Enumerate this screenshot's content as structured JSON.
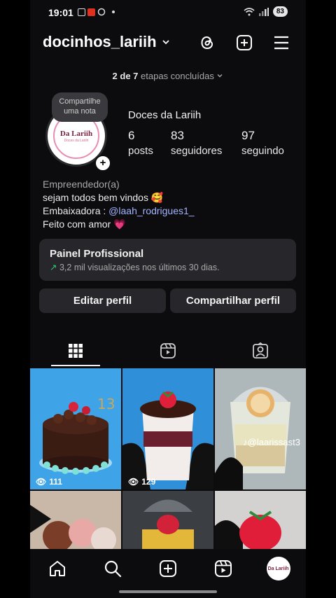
{
  "status": {
    "time": "19:01",
    "battery": "83"
  },
  "header": {
    "username": "docinhos_lariih"
  },
  "steps": {
    "count": "2 de 7",
    "label": "etapas concluídas"
  },
  "note": {
    "text": "Compartilhe uma nota"
  },
  "avatar": {
    "logo_text": "Da Lariih",
    "logo_sub": "Doces da Lariih"
  },
  "profile": {
    "name": "Doces da Lariih",
    "stats": [
      {
        "value": "6",
        "label": "posts"
      },
      {
        "value": "83",
        "label": "seguidores"
      },
      {
        "value": "97",
        "label": "seguindo"
      }
    ],
    "bio": {
      "category": "Empreendedor(a)",
      "line1": "sejam todos bem vindos 🥰",
      "line2_prefix": "Embaixadora : ",
      "line2_mention": "@laah_rodrigues1_",
      "line3": "Feito com amor 💗"
    }
  },
  "dashboard": {
    "title": "Painel Profissional",
    "subtitle": "3,2 mil visualizações nos últimos 30 dias."
  },
  "buttons": {
    "edit": "Editar perfil",
    "share": "Compartilhar perfil"
  },
  "tabs": [
    "grid-icon",
    "reels-icon",
    "tagged-icon"
  ],
  "posts": [
    {
      "views": "111"
    },
    {
      "views": "129"
    },
    {
      "watermark": "@laarissast3"
    }
  ],
  "nav": [
    "home-icon",
    "search-icon",
    "create-icon",
    "reels-icon",
    "profile-avatar"
  ]
}
